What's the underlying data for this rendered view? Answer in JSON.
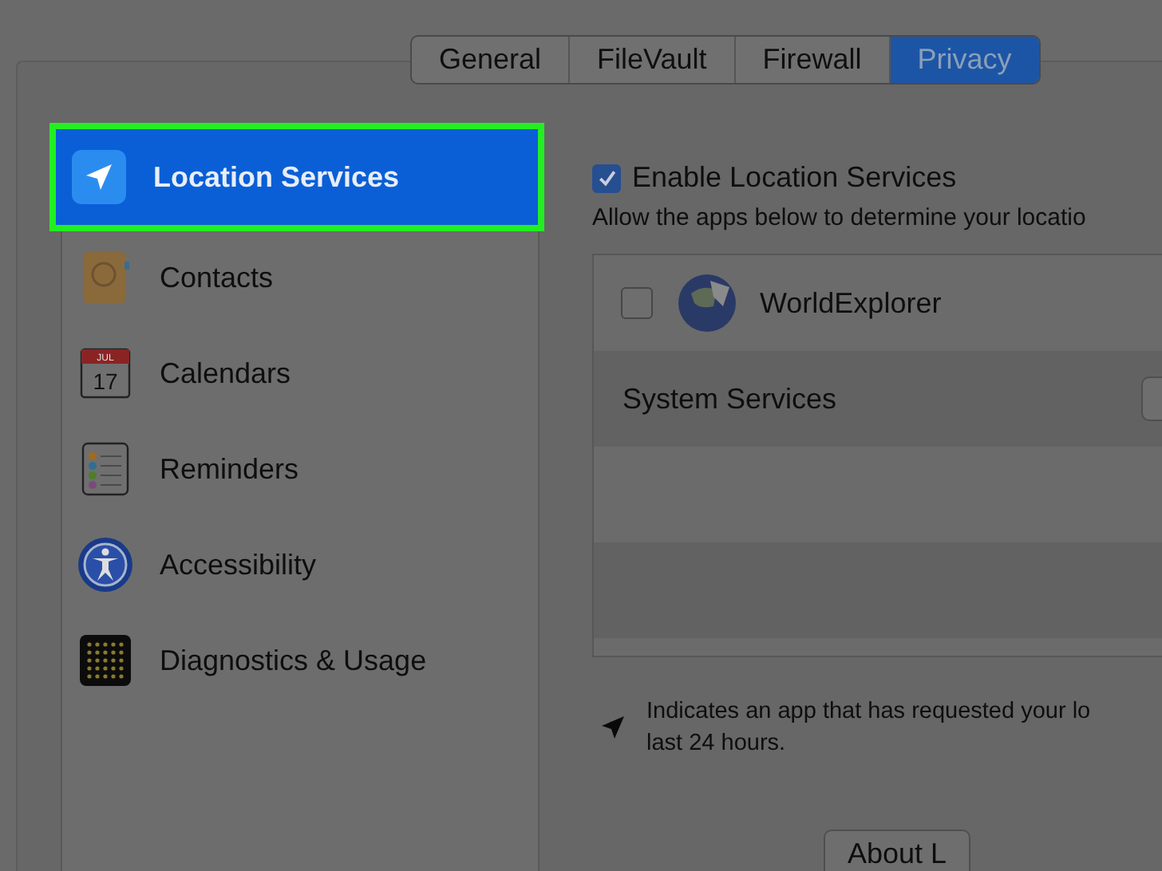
{
  "tabs": [
    {
      "label": "General",
      "selected": false
    },
    {
      "label": "FileVault",
      "selected": false
    },
    {
      "label": "Firewall",
      "selected": false
    },
    {
      "label": "Privacy",
      "selected": true
    }
  ],
  "sidebar": {
    "items": [
      {
        "label": "Location Services",
        "kind": "location",
        "selected": true,
        "highlighted": true
      },
      {
        "label": "Contacts",
        "kind": "contacts",
        "selected": false,
        "highlighted": false
      },
      {
        "label": "Calendars",
        "kind": "calendar",
        "selected": false,
        "highlighted": false,
        "icon_month": "JUL",
        "icon_day": "17"
      },
      {
        "label": "Reminders",
        "kind": "reminders",
        "selected": false,
        "highlighted": false
      },
      {
        "label": "Accessibility",
        "kind": "accessibility",
        "selected": false,
        "highlighted": false
      },
      {
        "label": "Diagnostics & Usage",
        "kind": "diagnostics",
        "selected": false,
        "highlighted": false
      }
    ]
  },
  "enable": {
    "label": "Enable Location Services",
    "checked": true
  },
  "description": "Allow the apps below to determine your locatio",
  "apps": [
    {
      "name": "WorldExplorer",
      "kind": "app",
      "checked": false
    },
    {
      "name": "System Services",
      "kind": "system"
    }
  ],
  "legend": {
    "line1": "Indicates an app that has requested your lo",
    "line2": "last 24 hours."
  },
  "about_button": "About L"
}
